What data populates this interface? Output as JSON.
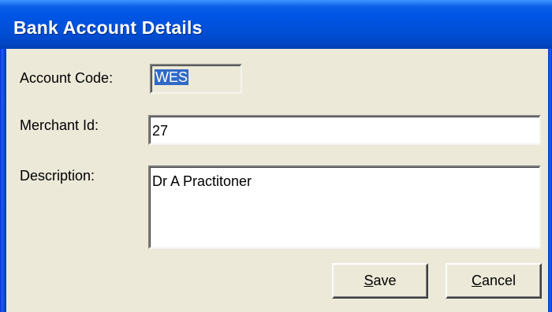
{
  "window": {
    "title": "Bank Account Details"
  },
  "form": {
    "account_code": {
      "label": "Account Code:",
      "value": "WES"
    },
    "merchant_id": {
      "label": "Merchant Id:",
      "value": "27"
    },
    "description": {
      "label": "Description:",
      "value": "Dr A Practitoner"
    }
  },
  "buttons": {
    "save": {
      "accel": "S",
      "rest": "ave"
    },
    "cancel": {
      "accel": "C",
      "rest": "ancel"
    }
  },
  "colors": {
    "titlebar": "#0055e5",
    "dialog_bg": "#ece9d8",
    "selection": "#316ac5"
  }
}
